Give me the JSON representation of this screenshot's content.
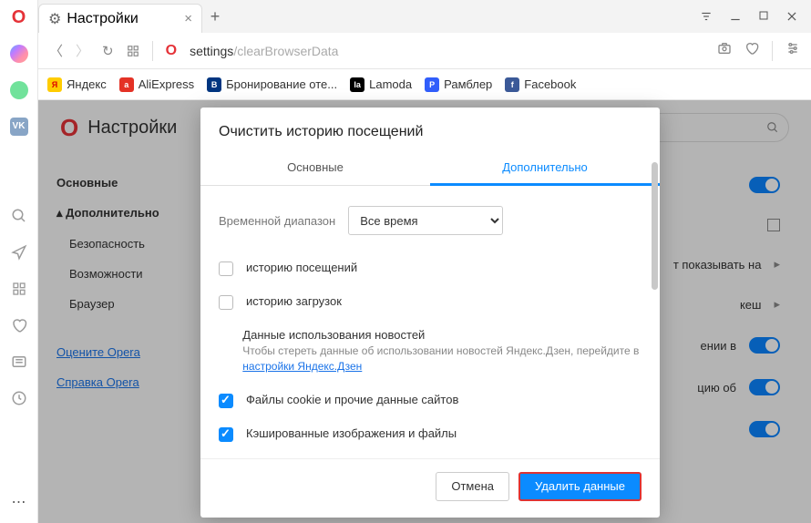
{
  "tab": {
    "title": "Настройки"
  },
  "url": {
    "prefix": "settings",
    "suffix": "/clearBrowserData"
  },
  "bookmarks": [
    {
      "label": "Яндекс",
      "ico": "ya",
      "glyph": "Я"
    },
    {
      "label": "AliExpress",
      "ico": "ali",
      "glyph": "a"
    },
    {
      "label": "Бронирование оте...",
      "ico": "book",
      "glyph": "B"
    },
    {
      "label": "Lamoda",
      "ico": "la",
      "glyph": "la"
    },
    {
      "label": "Рамблер",
      "ico": "ram",
      "glyph": "Р"
    },
    {
      "label": "Facebook",
      "ico": "fb",
      "glyph": "f"
    }
  ],
  "settings": {
    "title": "Настройки",
    "nav": {
      "basic": "Основные",
      "advanced": "Дополнительно",
      "security": "Безопасность",
      "features": "Возможности",
      "browser": "Браузер",
      "rate": "Оцените Opera",
      "help": "Справка Opera"
    },
    "rows": {
      "r1": "т показывать на",
      "r2": "кеш",
      "r3": "ении в",
      "r4": "цию об"
    }
  },
  "modal": {
    "title": "Очистить историю посещений",
    "tab_basic": "Основные",
    "tab_advanced": "Дополнительно",
    "range_label": "Временной диапазон",
    "range_value": "Все время",
    "items": {
      "history": "историю посещений",
      "downloads": "историю загрузок",
      "news_title": "Данные использования новостей",
      "news_sub_prefix": "Чтобы стереть данные об использовании новостей Яндекс.Дзен, перейдите в ",
      "news_link": "настройки Яндекс.Дзен",
      "cookies": "Файлы cookie и прочие данные сайтов",
      "cache": "Кэшированные изображения и файлы"
    },
    "cancel": "Отмена",
    "confirm": "Удалить данные"
  }
}
